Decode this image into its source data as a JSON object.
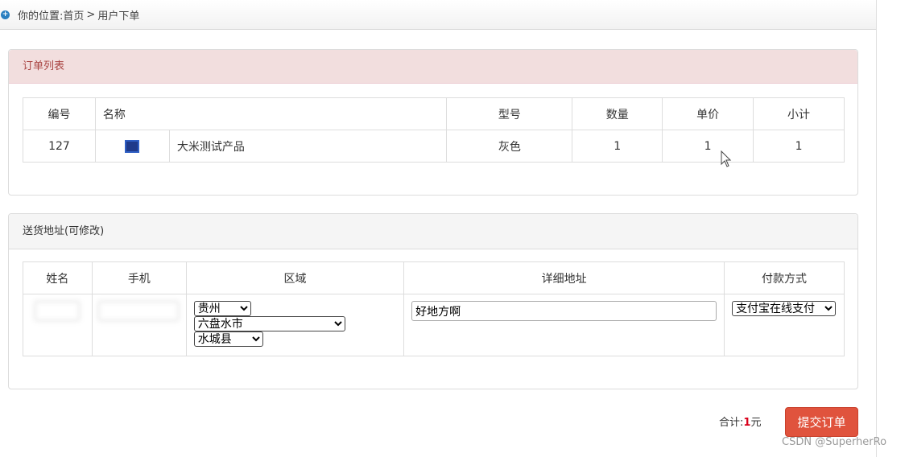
{
  "breadcrumb": {
    "prefix": "你的位置:",
    "home": "首页",
    "separator": ">",
    "current": "用户下单"
  },
  "order_panel": {
    "title": "订单列表",
    "headers": {
      "id": "编号",
      "name": "名称",
      "model": "型号",
      "qty": "数量",
      "unit_price": "单价",
      "subtotal": "小计"
    },
    "rows": [
      {
        "id": "127",
        "product_name": "大米测试产品",
        "model": "灰色",
        "qty": "1",
        "unit_price": "1",
        "subtotal": "1"
      }
    ]
  },
  "address_panel": {
    "title": "送货地址(可修改)",
    "headers": {
      "name": "姓名",
      "phone": "手机",
      "region": "区域",
      "address": "详细地址",
      "payment": "付款方式"
    },
    "province": "贵州",
    "city": "六盘水市",
    "county": "水城县",
    "address_value": "好地方啊",
    "payment_method": "支付宝在线支付"
  },
  "footer": {
    "total_label": "合计:",
    "total_value": "1",
    "currency": "元",
    "submit_label": "提交订单"
  },
  "watermark": "CSDN @SuperherRo",
  "colors": {
    "order_header_bg": "#f2dede",
    "order_header_text": "#a94442",
    "submit_bg": "#e0533d",
    "total_value": "#d9001b",
    "breadcrumb_icon": "#2a7fc0"
  }
}
